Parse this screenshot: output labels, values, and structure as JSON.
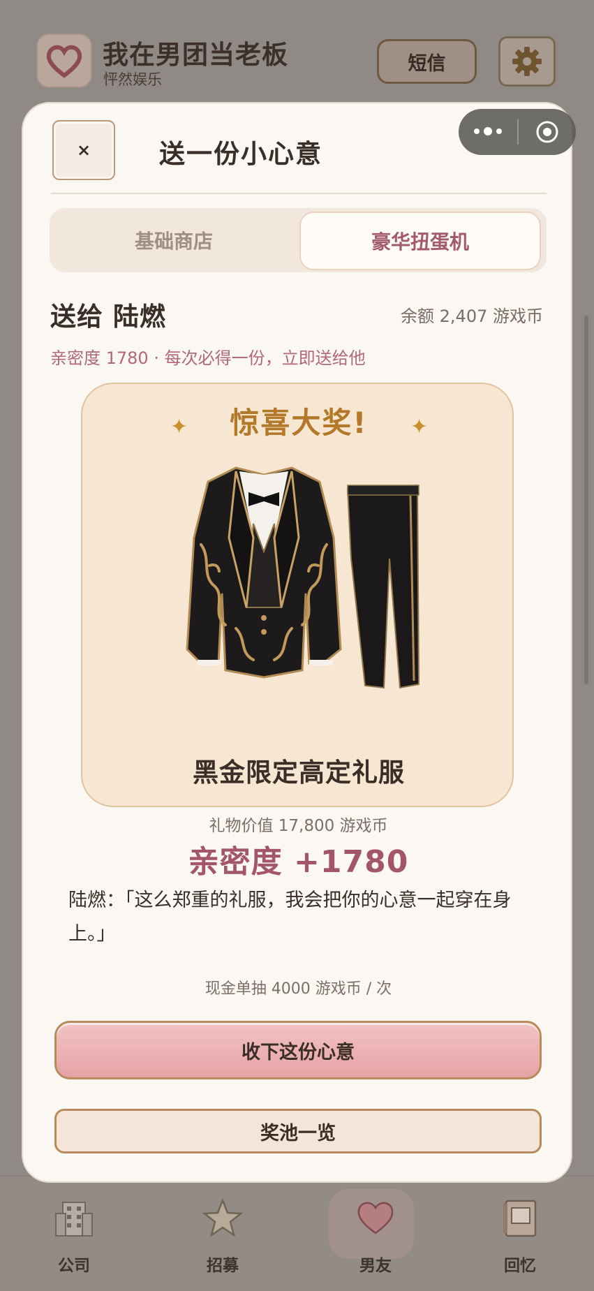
{
  "app": {
    "title": "我在男团当老板",
    "subtitle": "怦然娱乐",
    "sms_label": "短信"
  },
  "modal": {
    "close_label": "×",
    "title": "送一份小心意",
    "tabs": [
      {
        "label": "基础商店",
        "active": false
      },
      {
        "label": "豪华扭蛋机",
        "active": true
      }
    ],
    "send_to": "送给 陆燃",
    "balance": "余额 2,407 游戏币",
    "intimacy_line": "亲密度 1780 · 每次必得一份，立即送给他",
    "prize": {
      "headline": "惊喜大奖!",
      "name": "黑金限定高定礼服",
      "image_icon": "tuxedo-suit-icon"
    },
    "gift_value": "礼物价值 17,800 游戏币",
    "intimacy_gain": "亲密度 +1780",
    "quote": "陆燃：「这么郑重的礼服，我会把你的心意一起穿在身上。」",
    "price_line": "现金单抽 4000 游戏币 / 次",
    "accept_label": "收下这份心意",
    "pool_label": "奖池一览"
  },
  "nav": [
    {
      "label": "公司",
      "icon": "building-icon",
      "active": false
    },
    {
      "label": "招募",
      "icon": "star-icon",
      "active": false
    },
    {
      "label": "男友",
      "icon": "heart-icon",
      "active": true
    },
    {
      "label": "回忆",
      "icon": "album-icon",
      "active": false
    }
  ],
  "colors": {
    "accent_pink": "#a35669",
    "gold": "#b2792a",
    "modal_bg": "#fbf7f2"
  }
}
